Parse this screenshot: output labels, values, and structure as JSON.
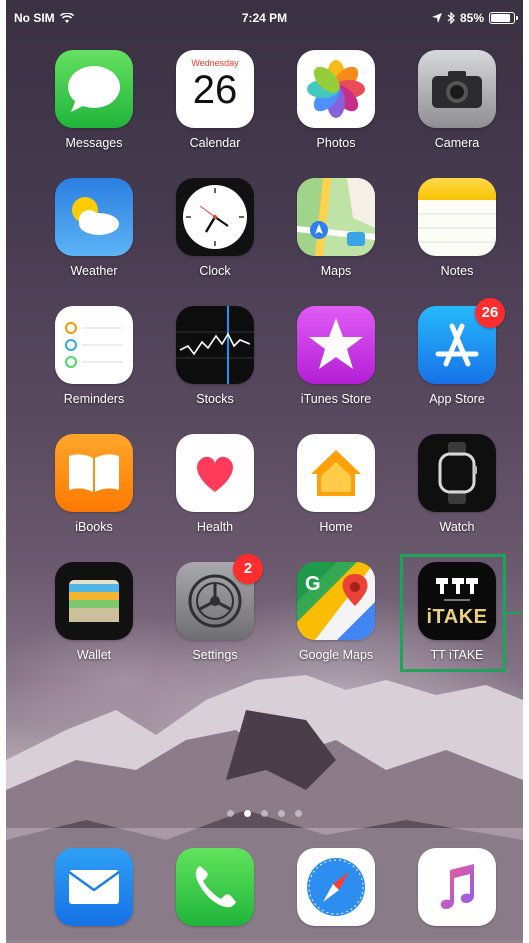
{
  "status_bar": {
    "carrier": "No SIM",
    "time": "7:24 PM",
    "battery": "85%",
    "battery_level": 0.85
  },
  "home_apps": [
    {
      "label": "Messages",
      "icon": "messages-icon"
    },
    {
      "label": "Calendar",
      "icon": "calendar-icon",
      "weekday": "Wednesday",
      "day": "26"
    },
    {
      "label": "Photos",
      "icon": "photos-icon"
    },
    {
      "label": "Camera",
      "icon": "camera-icon"
    },
    {
      "label": "Weather",
      "icon": "weather-icon"
    },
    {
      "label": "Clock",
      "icon": "clock-icon"
    },
    {
      "label": "Maps",
      "icon": "maps-icon"
    },
    {
      "label": "Notes",
      "icon": "notes-icon"
    },
    {
      "label": "Reminders",
      "icon": "reminders-icon"
    },
    {
      "label": "Stocks",
      "icon": "stocks-icon"
    },
    {
      "label": "iTunes Store",
      "icon": "itunes-store-icon"
    },
    {
      "label": "App Store",
      "icon": "app-store-icon",
      "badge": "26"
    },
    {
      "label": "iBooks",
      "icon": "ibooks-icon"
    },
    {
      "label": "Health",
      "icon": "health-icon"
    },
    {
      "label": "Home",
      "icon": "home-icon"
    },
    {
      "label": "Watch",
      "icon": "watch-icon"
    },
    {
      "label": "Wallet",
      "icon": "wallet-icon"
    },
    {
      "label": "Settings",
      "icon": "settings-icon",
      "badge": "2"
    },
    {
      "label": "Google Maps",
      "icon": "google-maps-icon"
    },
    {
      "label": "TT iTAKE",
      "icon": "tt-itake-icon",
      "icon_text": "iTAKE"
    }
  ],
  "dock_apps": [
    {
      "icon": "mail-icon"
    },
    {
      "icon": "phone-icon"
    },
    {
      "icon": "safari-icon"
    },
    {
      "icon": "music-icon"
    }
  ],
  "page_indicator": {
    "count": 5,
    "active": 1
  },
  "colors": {
    "highlight": "#1fa35a",
    "badge": "#ff2d2d"
  }
}
